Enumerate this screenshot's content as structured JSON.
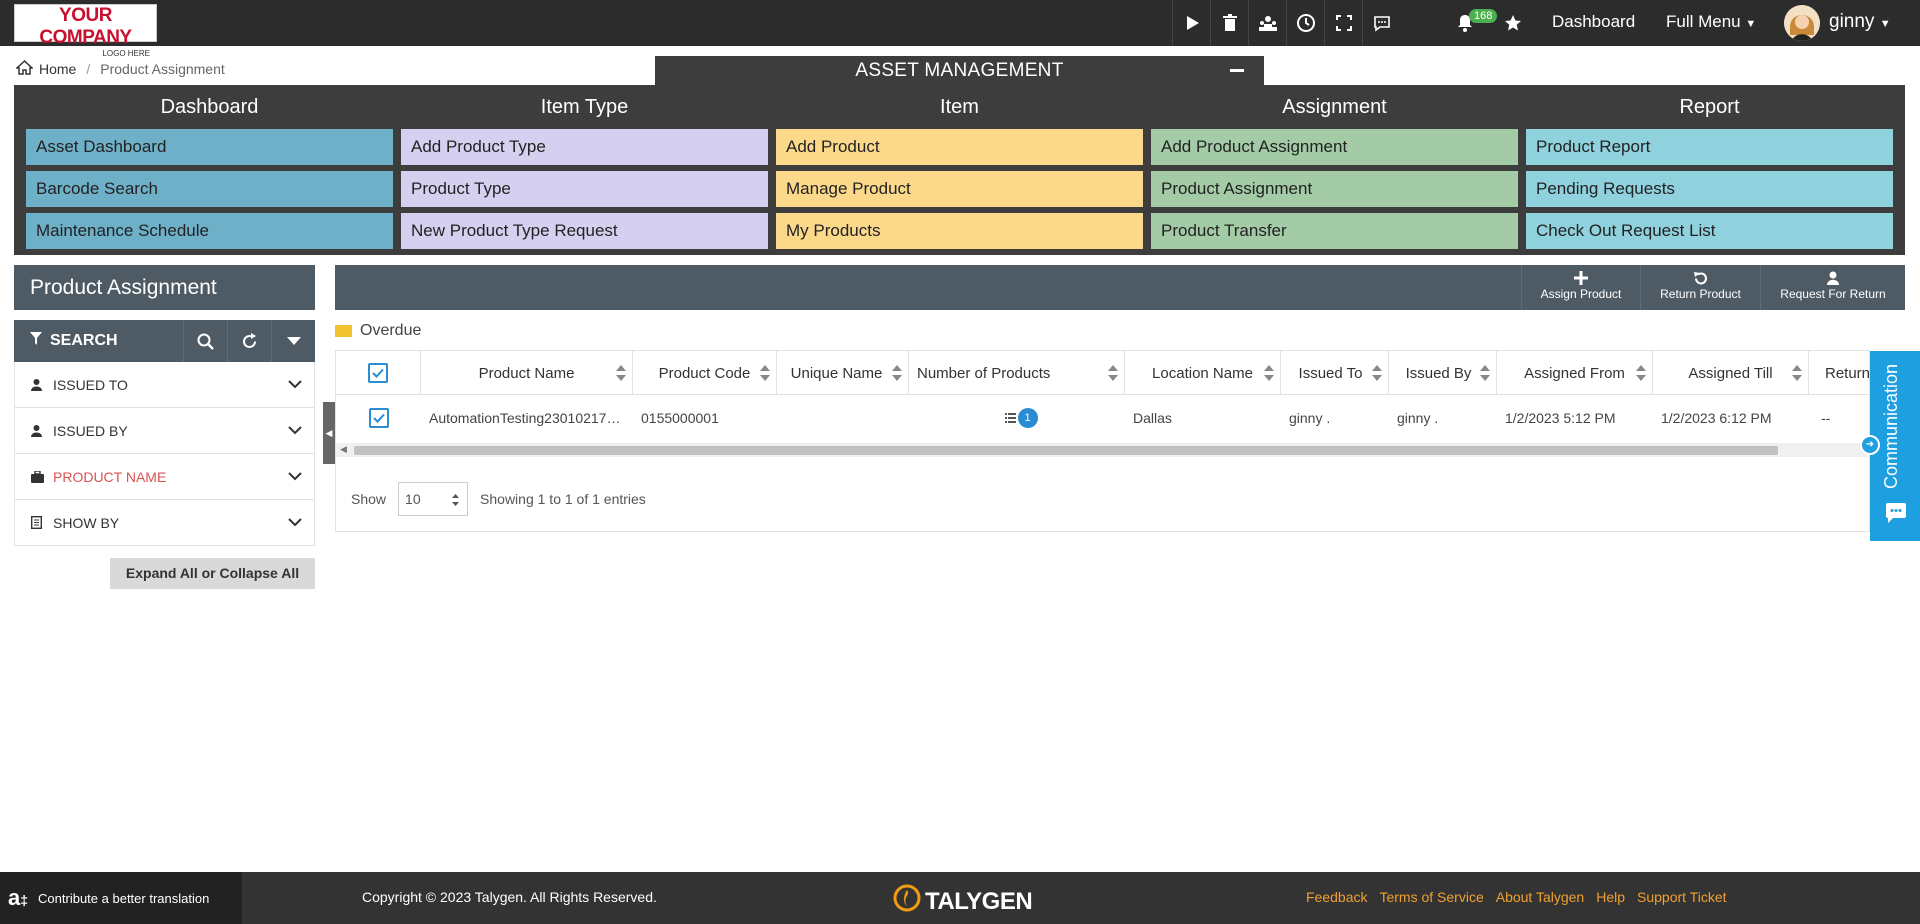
{
  "header": {
    "logo_line1": "YOUR COMPANY",
    "logo_line2": "LOGO HERE",
    "notification_count": "168",
    "dashboard_label": "Dashboard",
    "full_menu_label": "Full Menu",
    "user_name": "ginny"
  },
  "breadcrumb": {
    "home": "Home",
    "current": "Product Assignment"
  },
  "asset_management": {
    "title": "ASSET MANAGEMENT",
    "columns": [
      {
        "heading": "Dashboard",
        "color": "#6fb0c9",
        "items": [
          "Asset Dashboard",
          "Barcode Search",
          "Maintenance Schedule"
        ]
      },
      {
        "heading": "Item Type",
        "color": "#d5cff0",
        "items": [
          "Add Product Type",
          "Product Type",
          "New Product Type Request"
        ]
      },
      {
        "heading": "Item",
        "color": "#fcd98a",
        "items": [
          "Add Product",
          "Manage Product",
          "My Products"
        ]
      },
      {
        "heading": "Assignment",
        "color": "#a3cba6",
        "items": [
          "Add Product Assignment",
          "Product Assignment",
          "Product Transfer"
        ]
      },
      {
        "heading": "Report",
        "color": "#8fd1dd",
        "items": [
          "Product Report",
          "Pending Requests",
          "Check Out Request List"
        ]
      }
    ]
  },
  "sidebar": {
    "title": "Product Assignment",
    "search_label": "SEARCH",
    "filters": [
      {
        "label": "ISSUED TO",
        "icon": "user-icon"
      },
      {
        "label": "ISSUED BY",
        "icon": "user-icon"
      },
      {
        "label": "PRODUCT NAME",
        "icon": "briefcase-icon"
      },
      {
        "label": "SHOW BY",
        "icon": "document-icon"
      }
    ],
    "expand_label": "Expand All or Collapse All"
  },
  "actions": {
    "assign": "Assign Product",
    "return": "Return Product",
    "request_return": "Request For Return"
  },
  "legend": {
    "overdue": "Overdue"
  },
  "table": {
    "headers": [
      "Product Name",
      "Product Code",
      "Unique Name",
      "Number of Products",
      "Location Name",
      "Issued To",
      "Issued By",
      "Assigned From",
      "Assigned Till",
      "Return"
    ],
    "row": {
      "product_name": "AutomationTesting23010217…",
      "product_code": "0155000001",
      "unique_name": "",
      "number_of_products": "1",
      "location": "Dallas",
      "issued_to": "ginny .",
      "issued_by": "ginny .",
      "assigned_from": "1/2/2023 5:12 PM",
      "assigned_till": "1/2/2023 6:12 PM",
      "return": "--"
    }
  },
  "pager": {
    "show_label": "Show",
    "page_size": "10",
    "summary": "Showing 1 to 1 of 1 entries"
  },
  "communication": {
    "label": "Communication"
  },
  "footer": {
    "translate": "Contribute a better translation",
    "copyright": "Copyright © 2023 Talygen. All Rights Reserved.",
    "brand": "TALYGEN",
    "links": [
      "Feedback",
      "Terms of Service",
      "About Talygen",
      "Help",
      "Support Ticket"
    ]
  }
}
